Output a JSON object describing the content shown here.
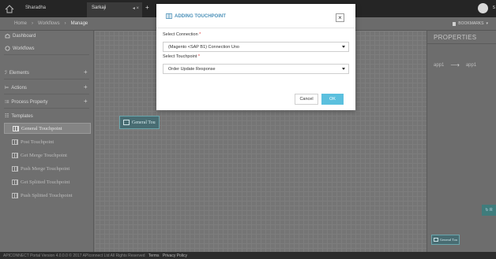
{
  "topbar": {
    "brand": "Sharadha",
    "tab_label": "Sarkaji",
    "tab_controls": "◂ ×",
    "tab_add": "+",
    "user_initial": "",
    "user_name": "S"
  },
  "breadcrumb": {
    "items": [
      "Home",
      "Workflows",
      "Manage"
    ],
    "separator": "›"
  },
  "bookmarks": {
    "label": "BOOKMARKS",
    "caret": "▾"
  },
  "sidebar": {
    "dashboard": "Dashboard",
    "workflows": "Workflows",
    "elements": "Elements",
    "actions": "Actions",
    "process_property": "Process Property",
    "templates": "Templates",
    "template_items": [
      "General Touchpoint",
      "Post Touchpoint",
      "Get Merge Touchpoint",
      "Push Merge Touchpoint",
      "Get Splitted Touchpoint",
      "Push Splitted Touchpoint"
    ],
    "active_index": 0
  },
  "canvas": {
    "node_label": "General Tou"
  },
  "properties": {
    "title": "PROPERTIES",
    "from_app": "app1",
    "to_app": "app1",
    "ext_button": "↻ R",
    "node_label": "General Tou"
  },
  "modal": {
    "title": "ADDING TOUCHPOINT",
    "close": "×",
    "connection_label": "Select Connection",
    "connection_value": "(Magento <SAP B1) Connection Uno",
    "touchpoint_label": "Select Touchpoint",
    "touchpoint_value": "Order Update Response",
    "required_mark": "*",
    "cancel_label": "Cancel",
    "ok_label": "OK"
  },
  "footer": {
    "text": "APICONNECT Portal  Version 4.0.0.0 © 2017 APIconnect Ltd All Rights Reserved",
    "terms": "Terms",
    "privacy": "Privacy Policy"
  },
  "colors": {
    "accent": "#5bc0de",
    "title_blue": "#4a90b8",
    "node_teal": "#486c72"
  }
}
